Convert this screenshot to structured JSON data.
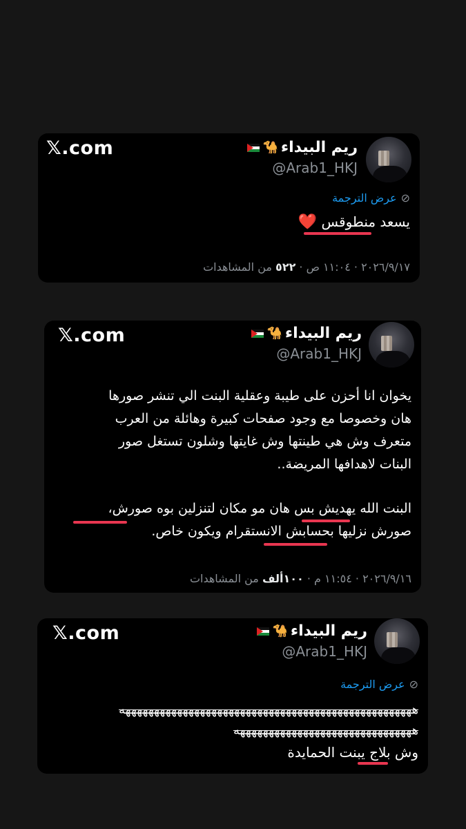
{
  "colors": {
    "background": "#161616",
    "card": "#000000",
    "link": "#1d9bf0",
    "underline": "#e83650",
    "muted": "#8b9096"
  },
  "tweets": [
    {
      "name": "ريم البيداء",
      "handle": "@Arab1_HKJ",
      "brand": "𝕏.com",
      "translate": "عرض الترجمة",
      "lines": [
        "يسعد منطوقس"
      ],
      "heart": "❤️",
      "meta_date": "٢٠٢٦/٩/١٧ · ١١:٠٤ ص · ",
      "meta_views": "٥٢٢",
      "meta_views_label": " من المشاهدات"
    },
    {
      "name": "ريم البيداء",
      "handle": "@Arab1_HKJ",
      "brand": "𝕏.com",
      "lines": [
        "يخوان انا أحزن على طيبة وعقلية البنت الي تنشر صورها",
        "هان وخصوصا مع وجود صفحات كبيرة وهائلة من العرب",
        "متعرف وش هي طينتها وش غايتها وشلون تستغل صور",
        "البنات لاهدافها المريضة..",
        "البنت الله يهديش بس هان مو مكان لتنزلين بوه صورش،",
        "صورش نزليها بحسابش الانستقرام ويكون خاص."
      ],
      "meta_date": "٢٠٢٦/٩/١٦ · ١١:٥٤ م · ",
      "meta_views": "١٠٠ألف",
      "meta_views_label": " من المشاهدات"
    },
    {
      "name": "ريم البيداء",
      "handle": "@Arab1_HKJ",
      "brand": "𝕏.com",
      "translate": "عرض الترجمة",
      "lines": [
        "هههههههههههههههههههههههههههههههههههههههههههههههههههه",
        "هههههههههههههههههههههههههههههههه",
        "وش بلاج يبنت الحمايدة"
      ]
    }
  ]
}
